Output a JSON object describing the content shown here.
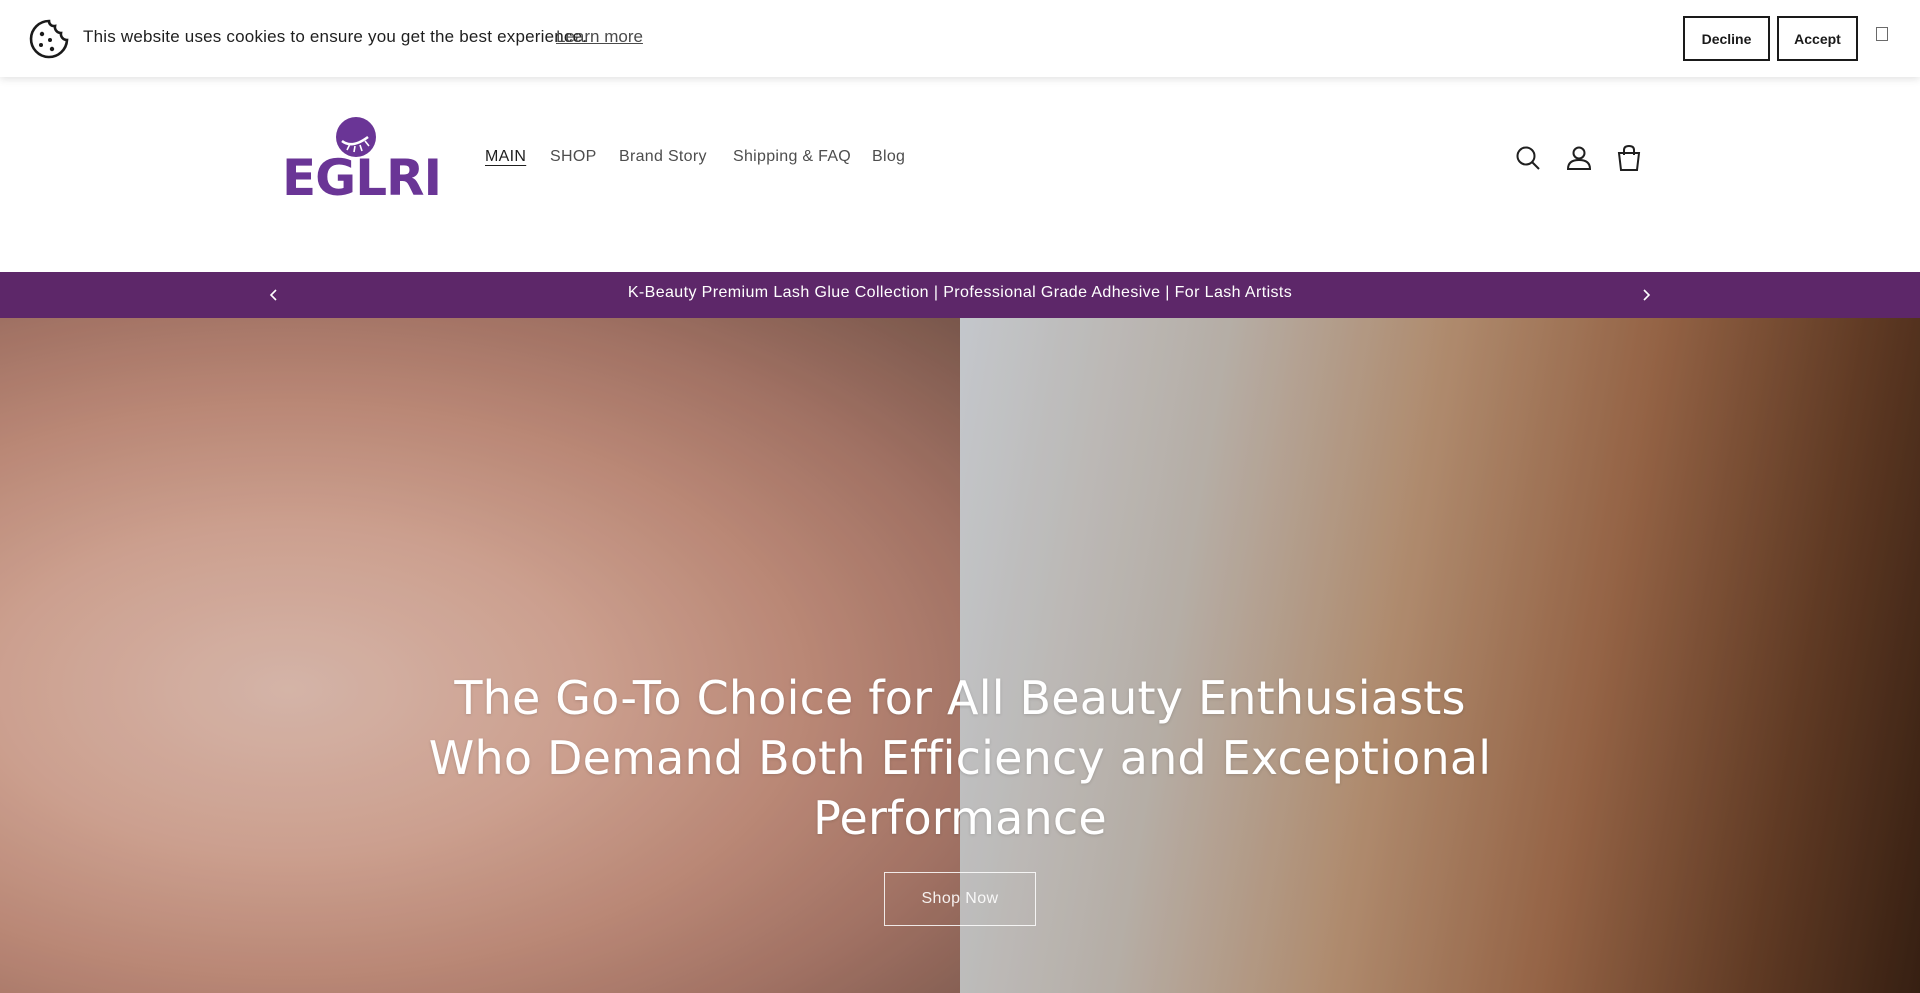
{
  "cookie_bar": {
    "message": "This website uses cookies to ensure you get the best experience.",
    "learn_more": "Learn more",
    "decline_label": "Decline",
    "accept_label": "Accept",
    "icon": "cookie-icon",
    "close_icon": "close-icon"
  },
  "header": {
    "logo_text": "EGLRI",
    "nav": [
      {
        "label": "MAIN",
        "active": true
      },
      {
        "label": "SHOP"
      },
      {
        "label": "Brand Story"
      },
      {
        "label": "Shipping & FAQ"
      },
      {
        "label": "Blog"
      }
    ],
    "icons": [
      "search-icon",
      "account-icon",
      "cart-icon"
    ]
  },
  "announcement": {
    "text": "K-Beauty Premium Lash Glue Collection | Professional Grade Adhesive | For Lash Artists"
  },
  "hero": {
    "title": "The Go-To Choice for All Beauty Enthusiasts Who Demand Both Efficiency and Exceptional Performance",
    "button_label": "Shop Now"
  },
  "colors": {
    "brand_purple": "#6a3596",
    "announcement_bg": "#5d2769",
    "text_dark": "#1f1f1f"
  }
}
